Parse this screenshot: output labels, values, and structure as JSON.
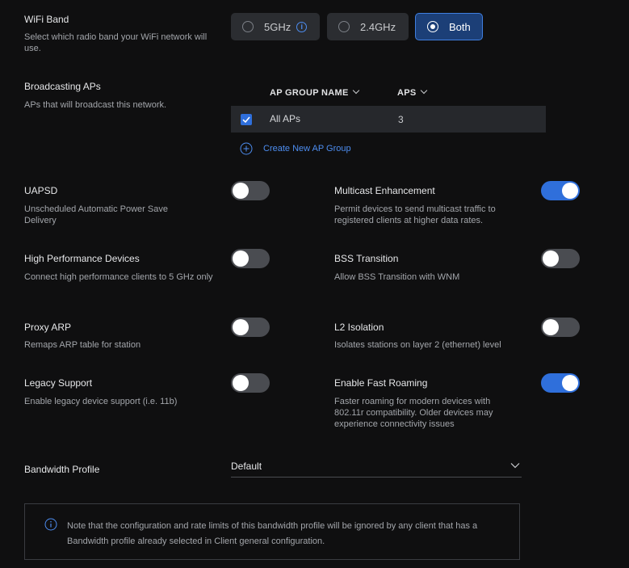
{
  "wifi_band": {
    "title": "WiFi Band",
    "description": "Select which radio band your WiFi network will use.",
    "options": [
      "5GHz",
      "2.4GHz",
      "Both"
    ],
    "selected": "Both"
  },
  "broadcasting": {
    "title": "Broadcasting APs",
    "description": "APs that will broadcast this network.",
    "columns": [
      "AP GROUP NAME",
      "APS"
    ],
    "rows": [
      {
        "name": "All APs",
        "aps": "3",
        "checked": true
      }
    ],
    "create_label": "Create New AP Group"
  },
  "toggles": {
    "uapsd": {
      "label": "UAPSD",
      "description": "Unscheduled Automatic Power Save Delivery",
      "on": false
    },
    "multicast": {
      "label": "Multicast Enhancement",
      "description": "Permit devices to send multicast traffic to registered clients at higher data rates.",
      "on": true
    },
    "high_perf": {
      "label": "High Performance Devices",
      "description": "Connect high performance clients to 5 GHz only",
      "on": false
    },
    "bss": {
      "label": "BSS Transition",
      "description": "Allow BSS Transition with WNM",
      "on": false
    },
    "proxy_arp": {
      "label": "Proxy ARP",
      "description": "Remaps ARP table for station",
      "on": false
    },
    "l2": {
      "label": "L2 Isolation",
      "description": "Isolates stations on layer 2 (ethernet) level",
      "on": false
    },
    "legacy": {
      "label": "Legacy Support",
      "description": "Enable legacy device support (i.e. 11b)",
      "on": false
    },
    "fast_roaming": {
      "label": "Enable Fast Roaming",
      "description": "Faster roaming for modern devices with 802.11r compatibility. Older devices may experience connectivity issues",
      "on": true
    }
  },
  "bandwidth": {
    "label": "Bandwidth Profile",
    "value": "Default",
    "note": "Note that the configuration and rate limits of this bandwidth profile will be ignored by any client that has a Bandwidth profile already selected in Client general configuration."
  },
  "colors": {
    "accent": "#2f6fdb",
    "background": "#0f0f10"
  }
}
